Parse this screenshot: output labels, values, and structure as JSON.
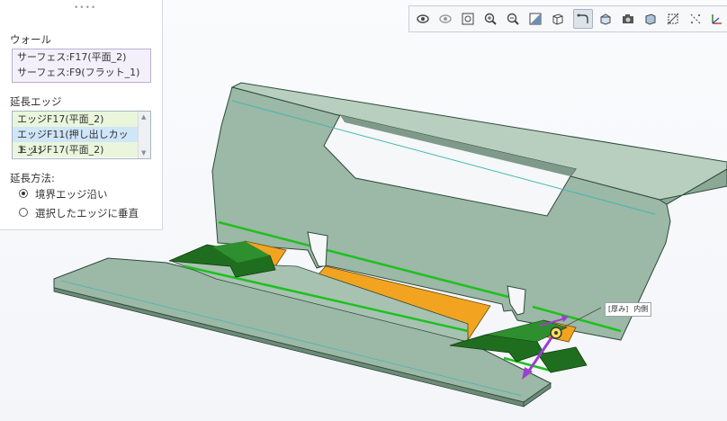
{
  "panel": {
    "wall_label": "ウォール",
    "wall_items": [
      "サーフェス:F17(平面_2)",
      "サーフェス:F9(フラット_1)"
    ],
    "edge_label": "延長エッジ",
    "edge_items": [
      "エッジF17(平面_2)",
      "エッジF11(押し出しカット_1)",
      "エッジF17(平面_2)"
    ],
    "method_label": "延長方法:",
    "method_options": [
      "境界エッジ沿い",
      "選択したエッジに垂直"
    ],
    "method_selected_index": 0
  },
  "toolbar": {
    "buttons": [
      "view-eye-icon",
      "view-hide-icon",
      "zoom-fit-icon",
      "zoom-in-icon",
      "zoom-out-icon",
      "section-icon",
      "box-view-icon",
      "sketch-icon",
      "saved-views-icon",
      "camera-icon",
      "display-style-icon",
      "datum-icon",
      "axis-icon",
      "csys-icon"
    ],
    "active_button": "sketch-icon"
  },
  "callout": {
    "thickness_label": "[厚み]",
    "side_label": "内側"
  },
  "colors": {
    "part_face": "#9cb8a6",
    "part_edge": "#2f4a3a",
    "highlight_green": "#1fc01f",
    "preview_orange": "#f2a421",
    "selected_dark_green": "#1f6e1f",
    "drag_arrow": "#9b3fd1"
  }
}
